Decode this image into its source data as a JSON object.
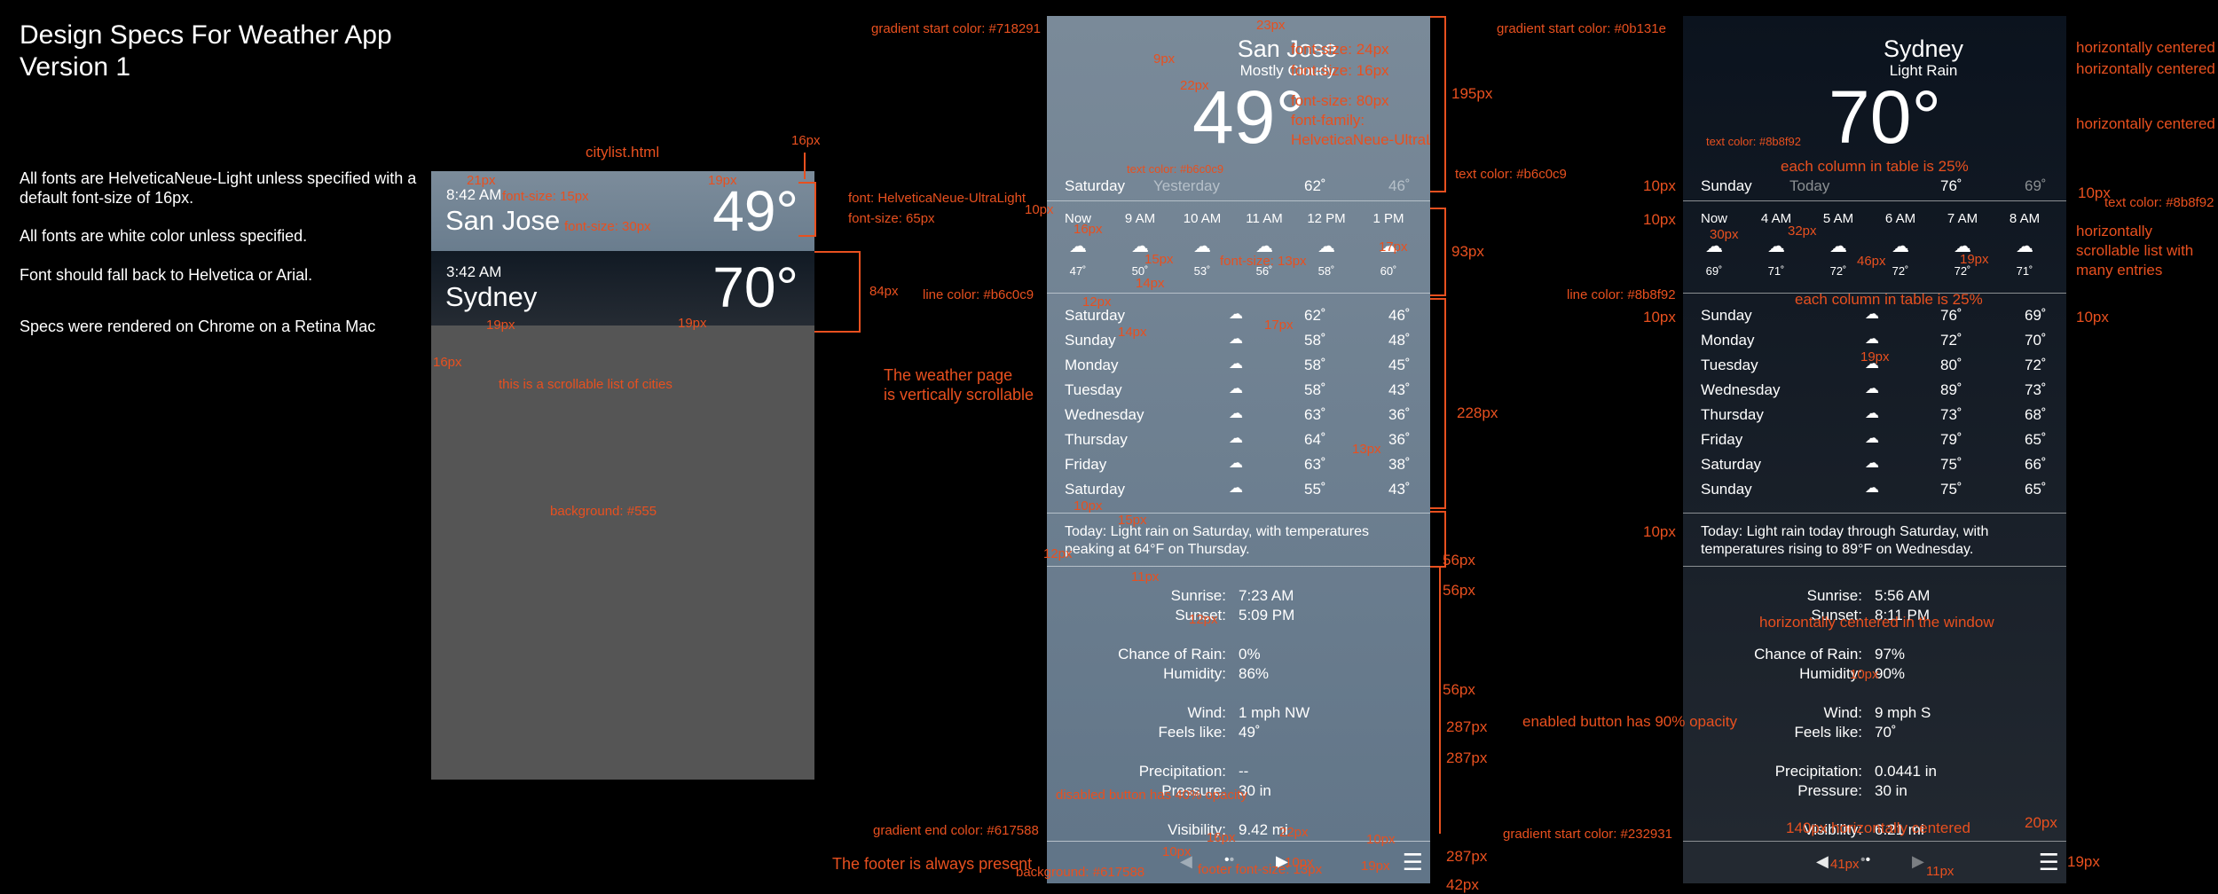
{
  "title": {
    "line1": "Design Specs For Weather App",
    "line2": "Version 1"
  },
  "notes": [
    "All fonts are HelveticaNeue-Light unless specified with a default font-size of 16px.",
    "All fonts are white color unless specified.",
    "Font should fall back to Helvetica or Arial.",
    "Specs were rendered on Chrome on a Retina Mac"
  ],
  "citylist": {
    "file_label": "citylist.html",
    "cities": [
      {
        "time": "8:42 AM",
        "name": "San Jose",
        "temp": "49°"
      },
      {
        "time": "3:42 AM",
        "name": "Sydney",
        "temp": "70°"
      }
    ],
    "scroll_note": "this is a scrollable list of cities",
    "bg_note": "background: #555",
    "font_note1": "font: HelveticaNeue-UltraLight",
    "font_note2": "font-size: 65px",
    "dim_21px": "21px",
    "dim_fs15": "font-size: 15px",
    "dim_fs30": "font-size: 30px",
    "dim_16px": "16px",
    "dim_19px": "19px",
    "dim_84px": "84px",
    "dim_16px_b": "16px",
    "dim_19px_b": "19px",
    "dim_19px_c": "19px"
  },
  "sanjose": {
    "city": "San Jose",
    "condition": "Mostly Cloudy",
    "temp": "49",
    "deg": "°",
    "today": {
      "day": "Saturday",
      "label": "Yesterday",
      "hi": "62˚",
      "lo": "46˚"
    },
    "hourly": [
      {
        "t": "Now",
        "temp": "47˚"
      },
      {
        "t": "9 AM",
        "temp": "50˚"
      },
      {
        "t": "10 AM",
        "temp": "53˚"
      },
      {
        "t": "11 AM",
        "temp": "56˚"
      },
      {
        "t": "12 PM",
        "temp": "58˚"
      },
      {
        "t": "1 PM",
        "temp": "60˚"
      }
    ],
    "daily": [
      {
        "day": "Saturday",
        "hi": "62˚",
        "lo": "46˚"
      },
      {
        "day": "Sunday",
        "hi": "58˚",
        "lo": "48˚"
      },
      {
        "day": "Monday",
        "hi": "58˚",
        "lo": "45˚"
      },
      {
        "day": "Tuesday",
        "hi": "58˚",
        "lo": "43˚"
      },
      {
        "day": "Wednesday",
        "hi": "63˚",
        "lo": "36˚"
      },
      {
        "day": "Thursday",
        "hi": "64˚",
        "lo": "36˚"
      },
      {
        "day": "Friday",
        "hi": "63˚",
        "lo": "38˚"
      },
      {
        "day": "Saturday",
        "hi": "55˚",
        "lo": "43˚"
      }
    ],
    "summary": "Today: Light rain on Saturday, with temperatures peaking at 64°F on Thursday.",
    "details": [
      {
        "k": "Sunrise:",
        "v": "7:23 AM"
      },
      {
        "k": "Sunset:",
        "v": "5:09 PM"
      },
      {
        "k": "Chance of Rain:",
        "v": "0%"
      },
      {
        "k": "Humidity:",
        "v": "86%"
      },
      {
        "k": "Wind:",
        "v": "1 mph NW"
      },
      {
        "k": "Feels like:",
        "v": "49˚"
      },
      {
        "k": "Precipitation:",
        "v": "--"
      },
      {
        "k": "Pressure:",
        "v": "30 in"
      },
      {
        "k": "Visibility:",
        "v": "9.42 mi"
      }
    ]
  },
  "sanjose_notes": {
    "gradient_start": "gradient start color: #718291",
    "gradient_end": "gradient end color: #617588",
    "scroll_note1": "The weather page",
    "scroll_note2": "is vertically scrollable",
    "footer_note": "The footer is always present",
    "line_color": "line color: #b6c0c9",
    "text_color_yesterday": "text color: #b6c0c9",
    "text_color_right": "text color: #b6c0c9",
    "fs24": "font-size: 24px",
    "fs16": "font-size: 16px",
    "fs80": "font-size: 80px",
    "ff": "font-family:",
    "ff2": "HelveticaNeue-UltraLight",
    "d23": "23px",
    "d9": "9px",
    "d22": "22px",
    "d195": "195px",
    "d93": "93px",
    "d228": "228px",
    "d56a": "56px",
    "d56b": "56px",
    "d56c": "56px",
    "d287a": "287px",
    "d287b": "287px",
    "d287c": "287px",
    "d42": "42px",
    "d10": "10px",
    "d16": "16px",
    "d15": "15px",
    "d14": "14px",
    "d17": "17px",
    "d17b": "17px",
    "d12": "12px",
    "d14b": "14px",
    "d13": "13px",
    "fs13": "font-size: 13px",
    "d10b": "10px",
    "d15b": "15px",
    "d11": "11px",
    "d12b": "12px",
    "disabled": "disabled button has 40% opacity",
    "d16b": "16px",
    "d22b": "22px",
    "d10c": "10px",
    "d10d": "10px",
    "d19": "19px",
    "bg_footer": "background: #617588",
    "fs_footer": "footer font-size: 13px"
  },
  "sydney": {
    "city": "Sydney",
    "condition": "Light Rain",
    "temp": "70",
    "deg": "°",
    "today": {
      "day": "Sunday",
      "label": "Today",
      "hi": "76˚",
      "lo": "69˚"
    },
    "hourly": [
      {
        "t": "Now",
        "temp": "69˚"
      },
      {
        "t": "4 AM",
        "temp": "71˚"
      },
      {
        "t": "5 AM",
        "temp": "72˚"
      },
      {
        "t": "6 AM",
        "temp": "72˚"
      },
      {
        "t": "7 AM",
        "temp": "72˚"
      },
      {
        "t": "8 AM",
        "temp": "71˚"
      }
    ],
    "daily": [
      {
        "day": "Sunday",
        "hi": "76˚",
        "lo": "69˚"
      },
      {
        "day": "Monday",
        "hi": "72˚",
        "lo": "70˚"
      },
      {
        "day": "Tuesday",
        "hi": "80˚",
        "lo": "72˚"
      },
      {
        "day": "Wednesday",
        "hi": "89˚",
        "lo": "73˚"
      },
      {
        "day": "Thursday",
        "hi": "73˚",
        "lo": "68˚"
      },
      {
        "day": "Friday",
        "hi": "79˚",
        "lo": "65˚"
      },
      {
        "day": "Saturday",
        "hi": "75˚",
        "lo": "66˚"
      },
      {
        "day": "Sunday",
        "hi": "75˚",
        "lo": "65˚"
      }
    ],
    "summary": "Today: Light rain today through Saturday, with temperatures rising to 89°F on Wednesday.",
    "details": [
      {
        "k": "Sunrise:",
        "v": "5:56 AM"
      },
      {
        "k": "Sunset:",
        "v": "8:11 PM"
      },
      {
        "k": "Chance of Rain:",
        "v": "97%"
      },
      {
        "k": "Humidity:",
        "v": "90%"
      },
      {
        "k": "Wind:",
        "v": "9 mph S"
      },
      {
        "k": "Feels like:",
        "v": "70˚"
      },
      {
        "k": "Precipitation:",
        "v": "0.0441 in"
      },
      {
        "k": "Pressure:",
        "v": "30 in"
      },
      {
        "k": "Visibility:",
        "v": "6.21 mi"
      }
    ]
  },
  "sydney_notes": {
    "gradient_start": "gradient start color: #0b131e",
    "gradient_end": "gradient start color: #232931",
    "hc1": "horizontally centered",
    "hc2": "horizontally centered",
    "hc3": "horizontally centered",
    "text_color_l": "text color: #8b8f92",
    "text_color_r": "text color: #8b8f92",
    "each_col1": "each column in table is 25%",
    "each_col2": "each column in table is 25%",
    "hscroll1": "horizontally",
    "hscroll2": "scrollable list with",
    "hscroll3": "many entries",
    "line_color": "line color: #8b8f92",
    "d10a": "10px",
    "d10b": "10px",
    "d10c": "10px",
    "d10d": "10px",
    "d10e": "10px",
    "d10f": "10px",
    "d30": "30px",
    "d32": "32px",
    "d46": "46px",
    "d19": "19px",
    "d19b": "19px",
    "hc_window": "horizontally centered in the window",
    "d10g": "10px",
    "enabled": "enabled button has 90% opacity",
    "hc140": "140px horizontally centered",
    "d20": "20px",
    "d19c": "19px",
    "d41": "41px",
    "d11": "11px"
  }
}
